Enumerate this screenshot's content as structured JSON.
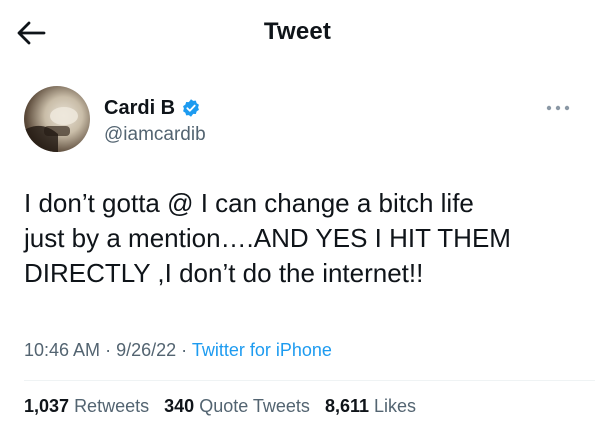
{
  "header": {
    "title": "Tweet",
    "back_icon": "arrow-left-icon"
  },
  "tweet": {
    "author": {
      "display_name": "Cardi B",
      "handle": "@iamcardib",
      "verified": true,
      "verified_color": "#1d9bf0"
    },
    "text": "I don’t gotta @ I can change a bitch life\njust by a mention….AND YES I HIT THEM\nDIRECTLY ,I don’t do the internet!!",
    "time": "10:46 AM",
    "date": "9/26/22",
    "separator": "·",
    "source": "Twitter for iPhone",
    "stats": {
      "retweets_count": "1,037",
      "retweets_label": "Retweets",
      "quotes_count": "340",
      "quotes_label": "Quote Tweets",
      "likes_count": "8,611",
      "likes_label": "Likes"
    }
  },
  "colors": {
    "accent": "#1d9bf0",
    "text_primary": "#0f1419",
    "text_secondary": "#536471",
    "divider": "#eff3f4"
  }
}
